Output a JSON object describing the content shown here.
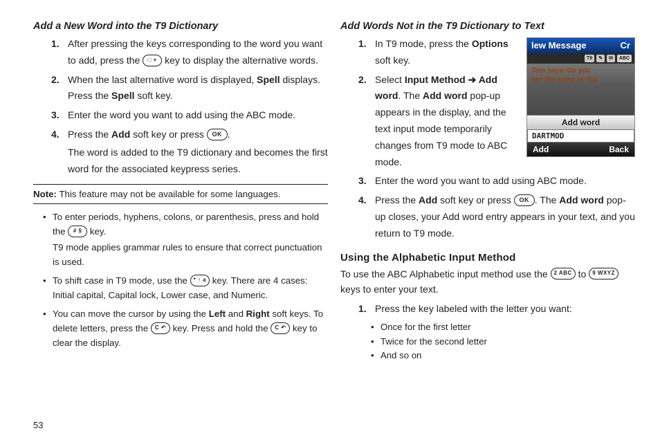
{
  "page_number": "53",
  "left": {
    "heading": "Add a New Word into the T9 Dictionary",
    "steps": [
      {
        "num": "1.",
        "t1": "After pressing the keys corresponding to the word you want to add, press the ",
        "key1": "□ +",
        "t2": " key to display the alternative words."
      },
      {
        "num": "2.",
        "t1": "When the last alternative word is displayed, ",
        "b1": "Spell",
        "t2": " displays. Press the ",
        "b2": "Spell",
        "t3": " soft key."
      },
      {
        "num": "3.",
        "t1": "Enter the word you want to add using the ABC mode."
      },
      {
        "num": "4.",
        "t1": "Press the ",
        "b1": "Add",
        "t2": " soft key or press ",
        "okbtn": true,
        "t3": ".",
        "after": "The word is added to the T9 dictionary and becomes the first word for the associated keypress series."
      }
    ],
    "note": {
      "label": "Note:",
      "text": " This feature may not be available for some languages."
    },
    "bullets": [
      {
        "t1": "To enter periods, hyphens, colons, or parenthesis, press and hold the ",
        "key1": "# §",
        "t2": " key.",
        "line2": "T9 mode applies grammar rules to ensure that correct punctuation is used."
      },
      {
        "t1": "To shift case in T9 mode, use the ",
        "key1": "* ↑ a",
        "t2": " key. There are 4 cases: Initial capital, Capital lock, Lower case, and Numeric."
      },
      {
        "t1": "You can move the cursor by using the ",
        "b1": "Left",
        "t2": " and ",
        "b2": "Right",
        "t3": " soft keys. To delete letters, press the ",
        "key1": "C ↶",
        "t4": " key. Press and hold the ",
        "key2": "C ↶",
        "t5": " key to clear the display."
      }
    ]
  },
  "right": {
    "heading": "Add Words Not in the T9 Dictionary to Text",
    "steps": [
      {
        "num": "1.",
        "t1": "In T9 mode, press the ",
        "b1": "Options",
        "t2": " soft key."
      },
      {
        "num": "2.",
        "t1": "Select ",
        "b1": "Input Method",
        "arrow": " ➔ ",
        "b2": "Add word",
        "t2": ". The ",
        "b3": "Add word",
        "t3": " pop-up appears in the display, and the text input mode temporarily changes from T9 mode to ABC mode."
      },
      {
        "num": "3.",
        "t1": "Enter the word you want to add using ABC mode."
      },
      {
        "num": "4.",
        "t1": "Press the ",
        "b1": "Add",
        "t2": " soft key or press ",
        "okbtn": true,
        "t3": ". The ",
        "b2": "Add word",
        "t4": " pop-up closes, your Add word entry appears in your text, and you return to T9 mode."
      }
    ],
    "phone": {
      "title_left": "lew Message",
      "title_right": "Cr",
      "status_abc": "ABC",
      "body_line1": "Tom says: Do you",
      "body_line2": "see the spies on the",
      "popup_label": "Add word",
      "popup_input": "DARTMOD",
      "soft_left": "Add",
      "soft_right": "Back"
    },
    "sec2_heading": "Using the Alphabetic Input Method",
    "sec2_intro": {
      "t1": "To use the ABC Alphabetic input method use the ",
      "key1": "2 ABC",
      "t2": " to ",
      "key2": "9 WXYZ",
      "t3": " keys to enter your text."
    },
    "sec2_steps": [
      {
        "num": "1.",
        "t1": "Press the key labeled with the letter you want:"
      }
    ],
    "sec2_sub": [
      "Once for the first letter",
      "Twice for the second letter",
      "And so on"
    ]
  }
}
